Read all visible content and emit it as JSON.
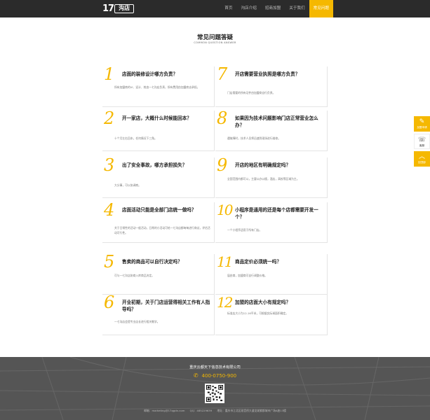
{
  "brand": {
    "logo_num": "17",
    "logo_text": "沟店"
  },
  "nav": {
    "items": [
      {
        "label": "首页"
      },
      {
        "label": "沟店介绍"
      },
      {
        "label": "招商加盟"
      },
      {
        "label": "关于我们"
      },
      {
        "label": "常见问题"
      }
    ],
    "active_index": 4
  },
  "page": {
    "title": "常见问题答疑",
    "subtitle": "COMMON QUESTION ANSWER"
  },
  "faqs": [
    {
      "num": "1",
      "q": "店面的装修设计哪方负责？",
      "a": "所有加盟商的VI、设计、统由一七沟店负责，所有费用由加盟商去承担。"
    },
    {
      "num": "2",
      "q": "开一家店，大概什么时候能回本？",
      "a": "十个月左右回本，任何情况下三角。"
    },
    {
      "num": "3",
      "q": "出了安全事故，哪方承担损失？",
      "a": "大分事，可以协调商。"
    },
    {
      "num": "4",
      "q": "店面活动只能是全部门店统一做吗？",
      "a": "关于日常性的活动一般活动，日常的小活动可给一七沟店都每每进行商议，评估活动可行性。"
    },
    {
      "num": "5",
      "q": "售卖的商品可以自行决定吗？",
      "a": "可与一七沟店协商入库商品决定。"
    },
    {
      "num": "6",
      "q": "开业初期，关于门店运营得相关工作有人指导吗？",
      "a": "一七沟店会提专业店长进行相关教学。"
    },
    {
      "num": "7",
      "q": "开店需要营业执照是哪方负责？",
      "a": "门店需要的所有证件由加盟商自行负责。"
    },
    {
      "num": "8",
      "q": "如果因为技术问题影响门店正常营业怎么办？",
      "a": "遇故障时，技术人员将迅速到现场进行维修。"
    },
    {
      "num": "9",
      "q": "开店的地区有明确规定吗？",
      "a": "全国范围内都可以，主要以办公楼，酒店，高校等区域为主。"
    },
    {
      "num": "10",
      "q": "小程序是通用的还是每个店都需要开发一个？",
      "a": "一个小程序适用于所有门店。"
    },
    {
      "num": "11",
      "q": "商品定价必须统一吗？",
      "a": "届由商，加盟商可自行调整价格。"
    },
    {
      "num": "12",
      "q": "加盟的店面大小有规定吗？",
      "a": "标准店大小为12-16平米，可根据实际调面积确定。"
    }
  ],
  "side": {
    "items": [
      {
        "icon": "✎",
        "label": "加盟申请"
      },
      {
        "icon": "☏",
        "label": "客服"
      },
      {
        "icon": "︿",
        "label": "回顶部"
      }
    ]
  },
  "footer": {
    "company": "重庆云都天下信息技术有限公司",
    "phone": "400-0750-900",
    "email": "邮箱：marketing@17qgdn.com",
    "qq": "QQ：485229639",
    "address": "地址：重庆市江北区观音桥大道龙湖紫都城市广场A座13楼",
    "colors": {
      "accent": "#f5b800",
      "header_bg": "#2b2b2b",
      "footer_bg": "#555555"
    }
  }
}
